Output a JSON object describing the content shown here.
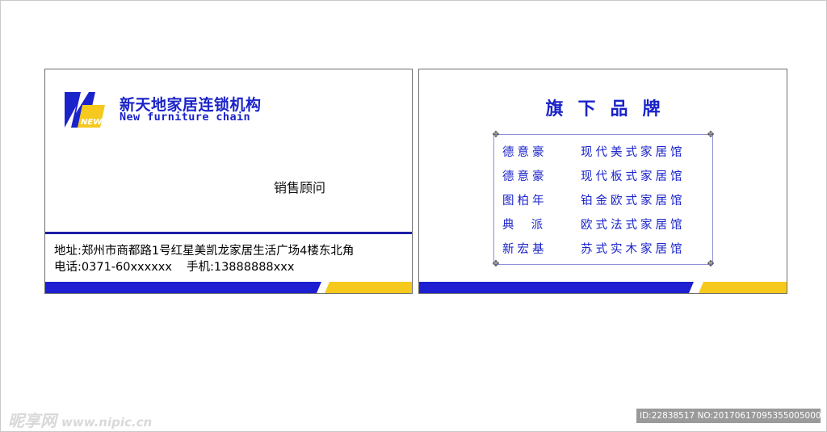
{
  "front_card": {
    "logo_text": "NEW",
    "company_cn": "新天地家居连锁机构",
    "company_en": "New furniture chain",
    "role": "销售顾问",
    "address": "地址:郑州市商都路1号红星美凯龙家居生活广场4楼东北角",
    "phone_label": "电话:",
    "phone": "0371-60xxxxxx",
    "mobile_label": "手机:",
    "mobile": "13888888xxx"
  },
  "back_card": {
    "title": "旗下品牌",
    "brands": [
      {
        "name": "德意豪",
        "desc": "现代美式家居馆"
      },
      {
        "name": "德意豪",
        "desc": "现代板式家居馆"
      },
      {
        "name": "图柏年",
        "desc": "铂金欧式家居馆"
      },
      {
        "name": "典  派",
        "desc": "欧式法式家居馆"
      },
      {
        "name": "新宏基",
        "desc": "苏式实木家居馆"
      }
    ]
  },
  "watermark": {
    "site_name": "昵享网",
    "site_url": "www.nipic.cn",
    "image_info": "ID:22838517 NO:20170617095355005000"
  },
  "colors": {
    "brand_blue": "#1a23c9",
    "stripe_blue": "#1d1fd0",
    "stripe_yellow": "#f5c91d"
  }
}
